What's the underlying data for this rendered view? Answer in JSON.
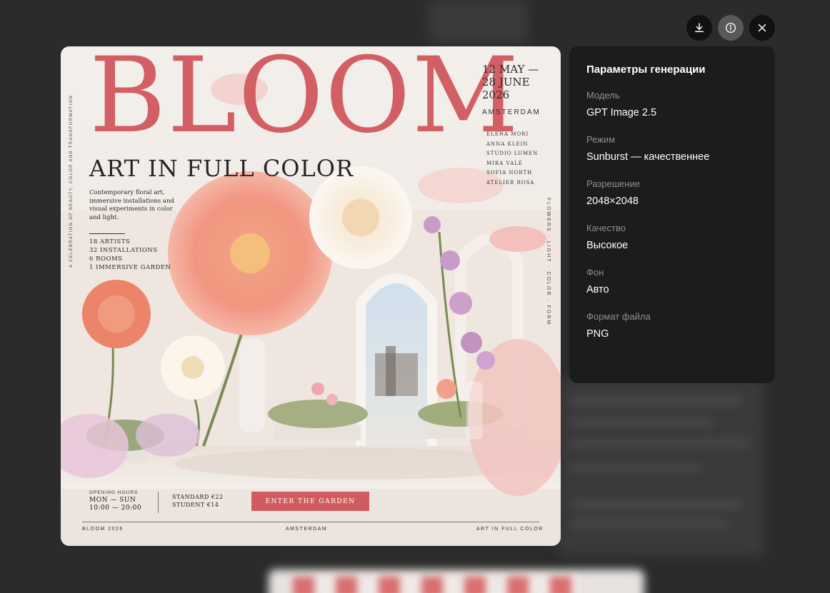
{
  "toolbar": {
    "download_icon": "download-icon",
    "info_icon": "info-icon",
    "close_icon": "close-icon"
  },
  "poster": {
    "title": "BLOOM",
    "subtitle": "ART IN FULL COLOR",
    "dates": "12 MAY — 28 JUNE 2026",
    "city": "AMSTERDAM",
    "artists": [
      "ELENA MORI",
      "ANNA KLEIN",
      "STUDIO LUMEN",
      "MIRA VALE",
      "SOFIA NORTH",
      "ATELIER ROSA"
    ],
    "description": "Contemporary floral art, immersive installations and visual experiments in color and light.",
    "stats": [
      "18  ARTISTS",
      "32  INSTALLATIONS",
      "6  ROOMS",
      "1  IMMERSIVE GARDEN"
    ],
    "vertical_left": "A CELEBRATION OF BEAUTY, COLOR AND TRANSFORMATION",
    "vertical_right": "FLOWERS · LIGHT · COLOR · FORM",
    "hours_label": "OPENING HOURS",
    "hours_days": "MON — SUN",
    "hours_time": "10:00 — 20:00",
    "price_standard": "STANDARD €22",
    "price_student": "STUDENT €14",
    "cta": "ENTER THE GARDEN",
    "footer_left": "BLOOM 2026",
    "footer_center": "AMSTERDAM",
    "footer_right": "ART IN FULL COLOR"
  },
  "panel": {
    "title": "Параметры генерации",
    "params": [
      {
        "label": "Модель",
        "value": "GPT Image 2.5"
      },
      {
        "label": "Режим",
        "value": "Sunburst — качественнее"
      },
      {
        "label": "Разрешение",
        "value": "2048×2048"
      },
      {
        "label": "Качество",
        "value": "Высокое"
      },
      {
        "label": "Фон",
        "value": "Авто"
      },
      {
        "label": "Формат файла",
        "value": "PNG"
      }
    ]
  },
  "colors": {
    "backdrop": "#2b2b2b",
    "panel_bg": "#1c1c1c",
    "accent_pink": "#d25f63",
    "label_gray": "#8f8f8f"
  }
}
